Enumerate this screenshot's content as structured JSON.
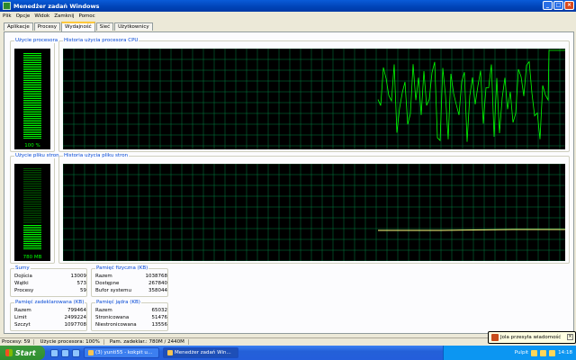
{
  "window": {
    "title": "Menedżer zadań Windows"
  },
  "menu": [
    "Plik",
    "Opcje",
    "Widok",
    "Zamknij",
    "Pomoc"
  ],
  "tabs": [
    "Aplikacje",
    "Procesy",
    "Wydajność",
    "Sieć",
    "Użytkownicy"
  ],
  "active_tab": "Wydajność",
  "cpu_usage": {
    "label": "Użycie procesora",
    "value_text": "100 %",
    "level": 1.0
  },
  "cpu_history": {
    "label": "Historia użycia procesora CPU"
  },
  "pagefile_usage": {
    "label": "Użycie pliku stron",
    "value_text": "780 MB",
    "level": 0.32
  },
  "pagefile_history": {
    "label": "Historia użycia pliku stron"
  },
  "totals": {
    "label": "Sumy",
    "rows": [
      {
        "name": "Dojścia",
        "value": "13009"
      },
      {
        "name": "Wątki",
        "value": "573"
      },
      {
        "name": "Procesy",
        "value": "59"
      }
    ]
  },
  "physical_memory": {
    "label": "Pamięć fizyczna (KB)",
    "rows": [
      {
        "name": "Razem",
        "value": "1038768"
      },
      {
        "name": "Dostępne",
        "value": "267840"
      },
      {
        "name": "Bufor systemu",
        "value": "358044"
      }
    ]
  },
  "commit_charge": {
    "label": "Pamięć zadeklarowana (KB)",
    "rows": [
      {
        "name": "Razem",
        "value": "799464"
      },
      {
        "name": "Limit",
        "value": "2499224"
      },
      {
        "name": "Szczyt",
        "value": "1097708"
      }
    ]
  },
  "kernel_memory": {
    "label": "Pamięć jądra (KB)",
    "rows": [
      {
        "name": "Razem",
        "value": "65032"
      },
      {
        "name": "Stronicowana",
        "value": "51476"
      },
      {
        "name": "Niestronicowana",
        "value": "13556"
      }
    ]
  },
  "status": {
    "processes": "Procesy: 59",
    "cpu": "Użycie procesora: 100%",
    "commit": "Pam. zadeklar.: 780M / 2440M"
  },
  "taskbar": {
    "start": "Start",
    "tasks": [
      "(3) yunti55 - kokpit u...",
      "Menedżer zadań Win..."
    ],
    "tray_text": "Pulpit",
    "clock": "14:18"
  },
  "balloon": {
    "text": "Jola przesyła wiadomość"
  },
  "colors": {
    "graph_line": "#00ff00",
    "grid": "#008040",
    "pagefile_line": "#ffff80"
  }
}
